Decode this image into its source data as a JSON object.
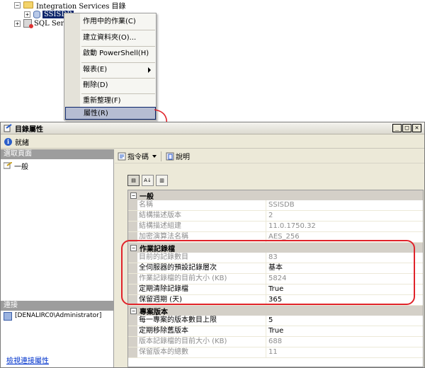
{
  "tree": {
    "nodes": [
      {
        "label": "Integration Services 目錄",
        "expander": "−"
      },
      {
        "label": "SSISDB",
        "expander": "+"
      },
      {
        "label": "SQL Serve",
        "expander": "+"
      }
    ]
  },
  "context_menu": {
    "items": [
      {
        "label": "作用中的作業(C)"
      },
      {
        "label": "建立資料夾(O)..."
      },
      {
        "label": "啟動 PowerShell(H)"
      },
      {
        "label": "報表(E)"
      },
      {
        "label": "刪除(D)"
      },
      {
        "label": "重新整理(F)"
      },
      {
        "label": "屬性(R)"
      }
    ]
  },
  "dialog": {
    "title": "目錄屬性",
    "window_buttons": [
      "_",
      "□",
      "✕"
    ],
    "status": "就緒",
    "left": {
      "select_page_header": "選取頁面",
      "pages": [
        {
          "label": "一般"
        }
      ],
      "connection_header": "連接",
      "connection_text": "[DENALIRC0\\Administrator]",
      "connection_link": "檢視連接屬性"
    },
    "toolbar": {
      "script_label": "指令碼",
      "help_label": "說明"
    },
    "grid_buttons": [
      "▤",
      "A↓",
      "▥"
    ],
    "categories": [
      {
        "label": "一般",
        "rows": [
          {
            "name": "名稱",
            "value": "SSISDB",
            "readonly": true
          },
          {
            "name": "結構描述版本",
            "value": "2",
            "readonly": true
          },
          {
            "name": "結構描述組建",
            "value": "11.0.1750.32",
            "readonly": true
          },
          {
            "name": "加密演算法名稱",
            "value": "AES_256",
            "readonly": true
          }
        ]
      },
      {
        "label": "作業記錄檔",
        "rows": [
          {
            "name": "目前的記錄數目",
            "value": "83",
            "readonly": true
          },
          {
            "name": "全伺服器的預設記錄層次",
            "value": "基本",
            "readonly": false
          },
          {
            "name": "作業記錄檔的目前大小 (KB)",
            "value": "5824",
            "readonly": true
          },
          {
            "name": "定期清除記錄檔",
            "value": "True",
            "readonly": false
          },
          {
            "name": "保留週期 (天)",
            "value": "365",
            "readonly": false
          }
        ]
      },
      {
        "label": "專案版本",
        "rows": [
          {
            "name": "每一專案的版本數目上限",
            "value": "5",
            "readonly": false
          },
          {
            "name": "定期移除舊版本",
            "value": "True",
            "readonly": false
          },
          {
            "name": "版本記錄檔的目前大小 (KB)",
            "value": "688",
            "readonly": true
          },
          {
            "name": "保留版本的總數",
            "value": "11",
            "readonly": true
          }
        ]
      }
    ]
  },
  "colors": {
    "highlight_frame": "#e0232a",
    "selection": "#0a246a",
    "menu_highlight": "#b6bdd2"
  }
}
